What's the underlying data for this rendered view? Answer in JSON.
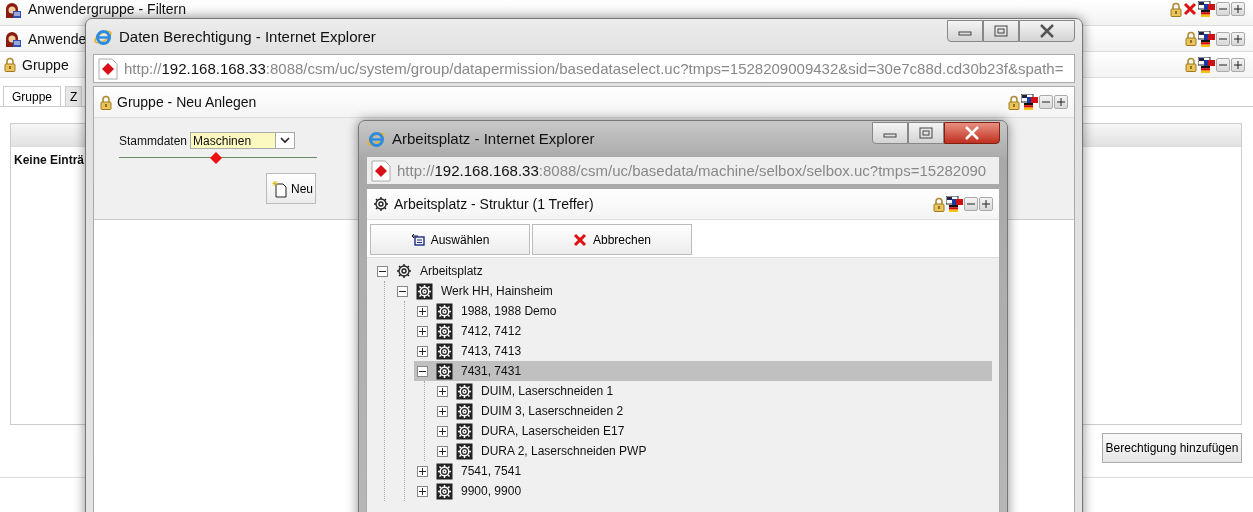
{
  "background": {
    "rows": [
      {
        "kind": "user-group",
        "title": "Anwendergruppe - Filtern",
        "removable": true
      },
      {
        "kind": "user-group",
        "title": "Anwende",
        "removable": false
      },
      {
        "kind": "lock",
        "title": "Gruppe",
        "removable": false
      }
    ],
    "tabs": [
      {
        "label": "Gruppe",
        "selected": true
      },
      {
        "label": "Z",
        "selected": false
      }
    ],
    "table": {
      "empty_text": "Keine Einträ"
    },
    "add_button": "Berechtigung hinzufügen"
  },
  "permission_window": {
    "title": "Daten Berechtigung - Internet Explorer",
    "active": false,
    "url": {
      "scheme": "http://",
      "host": "192.168.168.33",
      "rest": ":8088/csm/uc/system/group/datapermission/basedataselect.uc?tmps=1528209009432&sid=30e7c88d.cd30b23f&spath="
    },
    "panel": {
      "title": "Gruppe - Neu Anlegen",
      "field_label": "Stammdaten",
      "field_value": "Maschinen",
      "slider": {
        "level": 0.49
      },
      "new_button": "Neu"
    }
  },
  "workplace_window": {
    "title": "Arbeitsplatz - Internet Explorer",
    "active": true,
    "url": {
      "scheme": "http://",
      "host": "192.168.168.33",
      "rest": ":8088/csm/uc/basedata/machine/selbox/selbox.uc?tmps=15282090"
    },
    "panel": {
      "title": "Arbeitsplatz - Struktur (1 Treffer)",
      "buttons": [
        {
          "kind": "select",
          "label": "Auswählen"
        },
        {
          "kind": "cancel",
          "label": "Abbrechen"
        }
      ],
      "tree": [
        {
          "label": "Arbeitsplatz",
          "expanded": true,
          "selected": false,
          "children": [
            {
              "label": "Werk HH, Hainsheim",
              "expanded": true,
              "selected": false,
              "children": [
                {
                  "label": "1988, 1988 Demo",
                  "expanded": false,
                  "selected": false
                },
                {
                  "label": "7412, 7412",
                  "expanded": false,
                  "selected": false
                },
                {
                  "label": "7413, 7413",
                  "expanded": false,
                  "selected": false
                },
                {
                  "label": "7431, 7431",
                  "expanded": true,
                  "selected": true,
                  "children": [
                    {
                      "label": "DUIM, Laserschneiden 1",
                      "expanded": false,
                      "selected": false
                    },
                    {
                      "label": "DUIM 3, Laserschneiden 2",
                      "expanded": false,
                      "selected": false
                    },
                    {
                      "label": "DURA, Laserscheiden E17",
                      "expanded": false,
                      "selected": false
                    },
                    {
                      "label": "DURA 2, Laserschneiden PWP",
                      "expanded": false,
                      "selected": false
                    }
                  ]
                },
                {
                  "label": "7541, 7541",
                  "expanded": false,
                  "selected": false
                },
                {
                  "label": "9900, 9900",
                  "expanded": false,
                  "selected": false
                }
              ]
            }
          ]
        }
      ]
    }
  }
}
